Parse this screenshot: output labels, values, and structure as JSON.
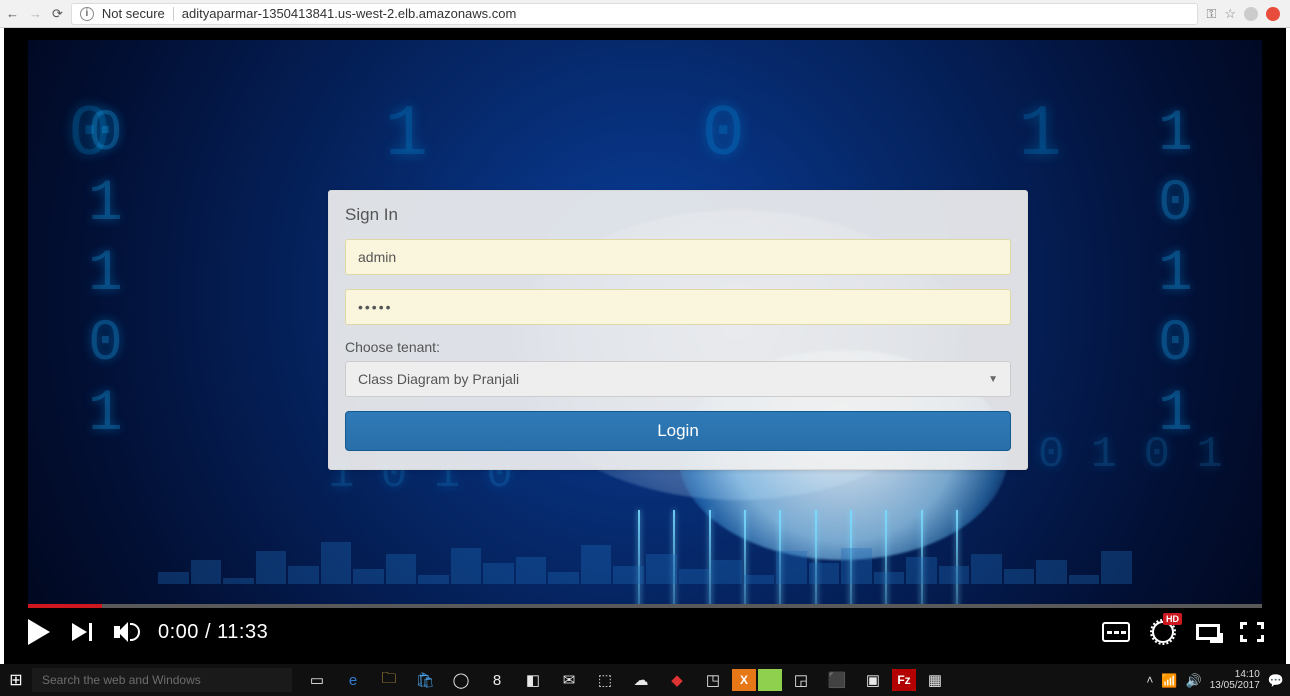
{
  "browser": {
    "security_label": "Not secure",
    "url": "adityaparmar-1350413841.us-west-2.elb.amazonaws.com"
  },
  "signin": {
    "title": "Sign In",
    "username_value": "admin",
    "password_masked": "•••••",
    "tenant_label": "Choose tenant:",
    "tenant_selected": "Class Diagram by Pranjali",
    "login_label": "Login"
  },
  "video": {
    "current_time": "0:00",
    "duration": "11:33",
    "hd_badge": "HD"
  },
  "taskbar": {
    "search_placeholder": "Search the web and Windows",
    "time": "14:10",
    "date": "13/05/2017"
  }
}
